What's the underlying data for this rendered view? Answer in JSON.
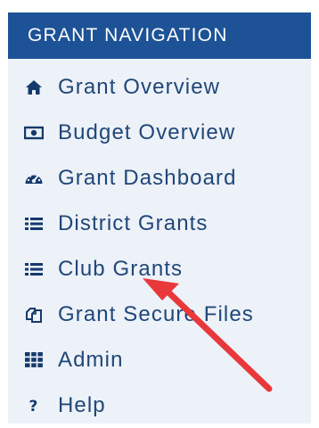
{
  "nav": {
    "title": "GRANT NAVIGATION",
    "items": [
      {
        "label": "Grant Overview",
        "icon": "home-icon"
      },
      {
        "label": "Budget Overview",
        "icon": "money-icon"
      },
      {
        "label": "Grant Dashboard",
        "icon": "dashboard-icon"
      },
      {
        "label": "District Grants",
        "icon": "list-icon"
      },
      {
        "label": "Club Grants",
        "icon": "list-icon"
      },
      {
        "label": "Grant Secure Files",
        "icon": "files-icon"
      },
      {
        "label": "Admin",
        "icon": "grid-icon"
      },
      {
        "label": "Help",
        "icon": "question-icon"
      }
    ]
  },
  "colors": {
    "header_bg": "#1d5296",
    "nav_bg": "#edf1f8",
    "text": "#1f4778",
    "arrow": "#e8383b"
  }
}
